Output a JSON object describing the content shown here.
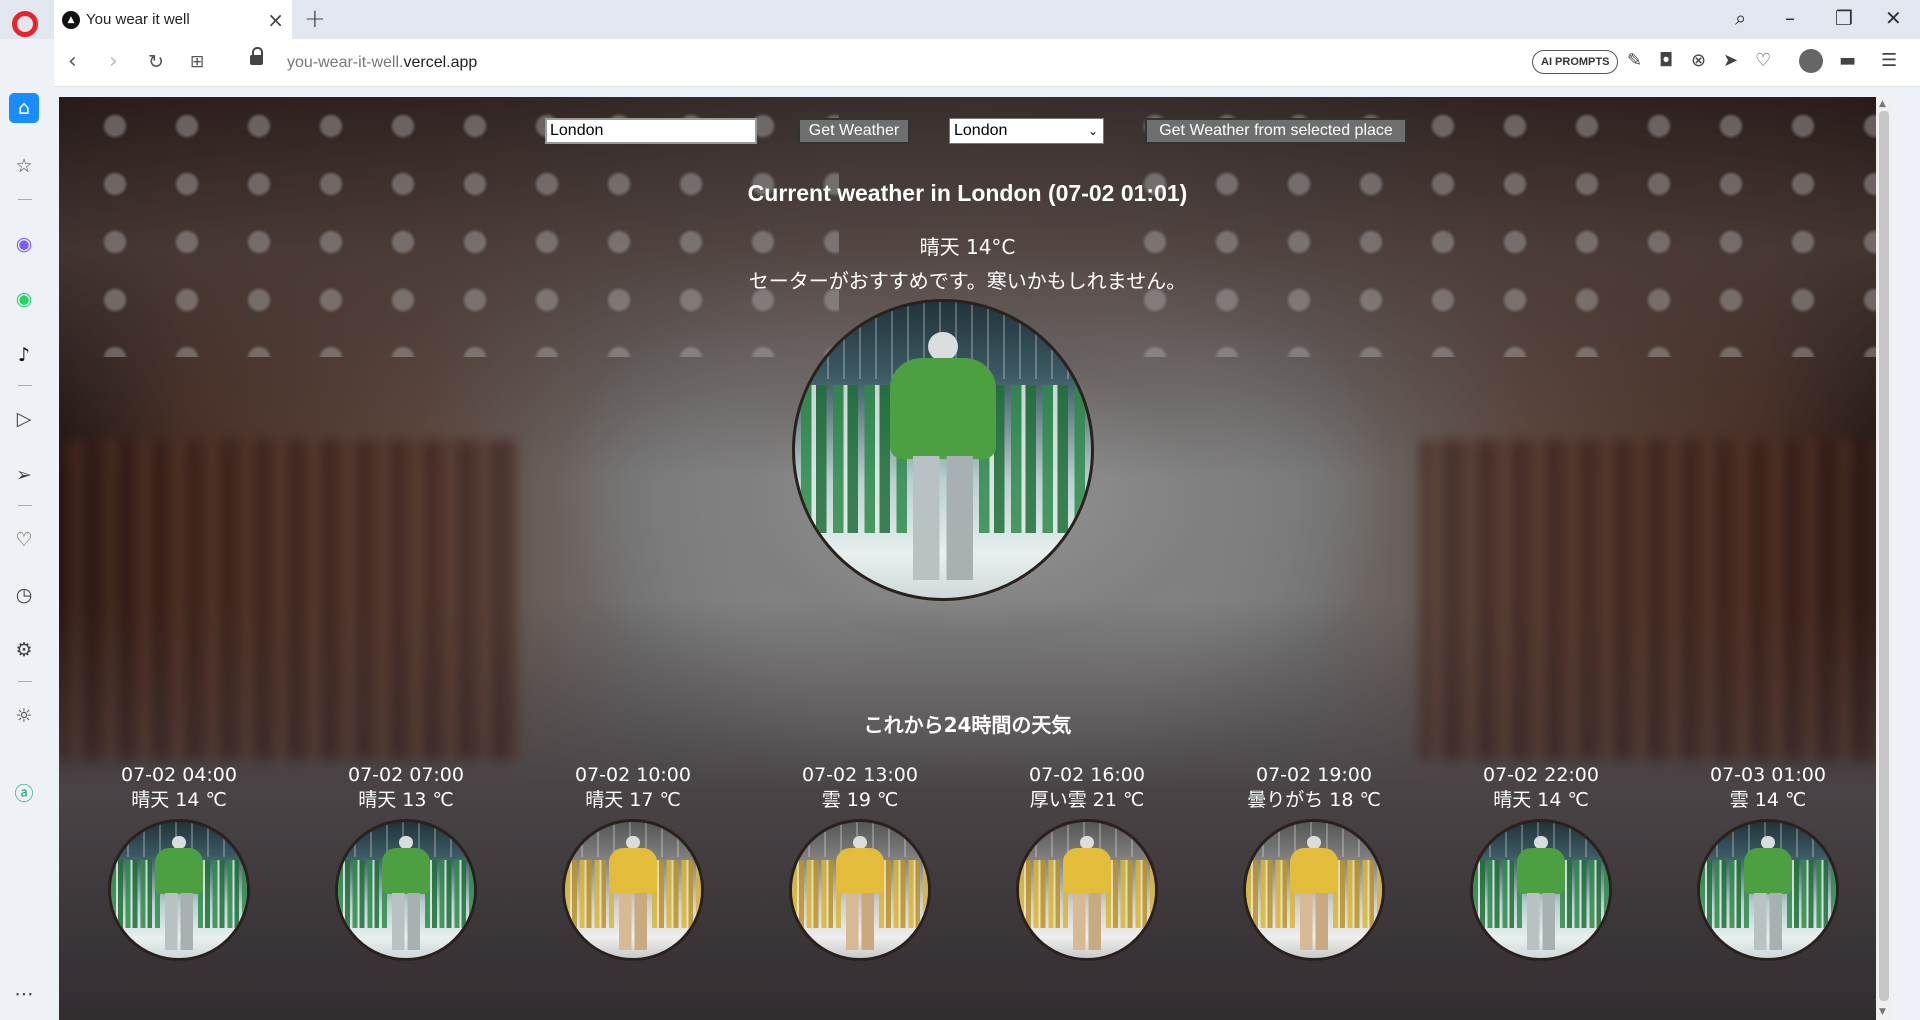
{
  "browser": {
    "tab_title": "You wear it well",
    "url_prefix": "you-wear-it-well.",
    "url_domain": "vercel.app",
    "ai_button": "AI PROMPTS"
  },
  "controls": {
    "city_input_value": "London",
    "get_weather_label": "Get Weather",
    "selected_city": "London",
    "get_selected_label": "Get Weather from selected place"
  },
  "current": {
    "heading": "Current weather in London (07-02 01:01)",
    "condition": "晴天 14°C",
    "advice": "セーターがおすすめです。寒いかもしれません。",
    "outfit": "green-sweater"
  },
  "forecast": {
    "title": "これから24時間の天気",
    "items": [
      {
        "time": "07-02 04:00",
        "cond": "晴天 14 ℃",
        "outfit": "green"
      },
      {
        "time": "07-02 07:00",
        "cond": "晴天 13 ℃",
        "outfit": "green"
      },
      {
        "time": "07-02 10:00",
        "cond": "晴天 17 ℃",
        "outfit": "yellow"
      },
      {
        "time": "07-02 13:00",
        "cond": "雲 19 ℃",
        "outfit": "yellow"
      },
      {
        "time": "07-02 16:00",
        "cond": "厚い雲 21 ℃",
        "outfit": "yellow"
      },
      {
        "time": "07-02 19:00",
        "cond": "曇りがち 18 ℃",
        "outfit": "yellow"
      },
      {
        "time": "07-02 22:00",
        "cond": "晴天 14 ℃",
        "outfit": "green"
      },
      {
        "time": "07-03 01:00",
        "cond": "雲 14 ℃",
        "outfit": "green"
      }
    ]
  },
  "colors": {
    "opera_red": "#e8232b",
    "home_blue": "#1a8cff",
    "button_gray": "#6e6e6e"
  }
}
